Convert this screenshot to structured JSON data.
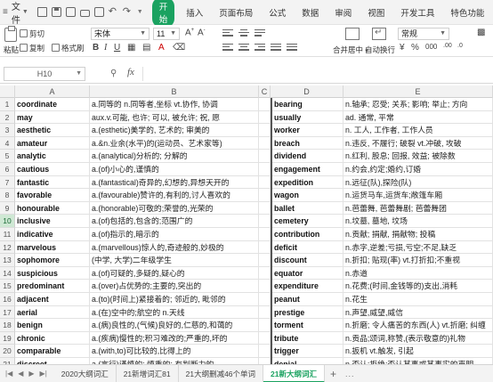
{
  "menu": {
    "file_label": "文件",
    "start_label": "开始",
    "tabs": [
      "插入",
      "页面布局",
      "公式",
      "数据",
      "审阅",
      "视图",
      "开发工具",
      "特色功能"
    ],
    "search_label": "查找"
  },
  "ribbon": {
    "cut_label": "剪切",
    "paste_label": "粘贴",
    "copy_label": "复制",
    "format_painter_label": "格式刷",
    "font_name": "宋体",
    "font_size": "11",
    "merge_label": "合并居中",
    "wrap_label": "自动换行",
    "number_format": "常规"
  },
  "formula_bar": {
    "name_box": "H10",
    "fx_label": "fx",
    "formula": ""
  },
  "columns": [
    "A",
    "B",
    "C",
    "D",
    "E"
  ],
  "rows": [
    {
      "n": "1",
      "a": "coordinate",
      "b": "a.同等的 n.同等者,坐标 vt.协作, 协调",
      "d": "bearing",
      "e": "n.轴承; 忍受; 关系; 影响; 举止; 方向"
    },
    {
      "n": "2",
      "a": "may",
      "b": "aux.v.可能, 也许; 可以, 被允许; 祝, 愿",
      "d": "usually",
      "e": "ad. 通常, 平常"
    },
    {
      "n": "3",
      "a": "aesthetic",
      "b": "a.(esthetic)美学的, 艺术的; 审美的",
      "d": "worker",
      "e": "n. 工人, 工作者, 工作人员"
    },
    {
      "n": "4",
      "a": "amateur",
      "b": "a.&n.业余(水平)的(运动员、艺术家等)",
      "d": "breach",
      "e": "n.违反, 不履行; 破裂 vt.冲破, 攻破"
    },
    {
      "n": "5",
      "a": "analytic",
      "b": "a.(analytical)分析的; 分解的",
      "d": "dividend",
      "e": "n.红利, 股息; 回报, 效益; 被除数"
    },
    {
      "n": "6",
      "a": "cautious",
      "b": "a.(of)小心的,谨慎的",
      "d": "engagement",
      "e": "n.约会,约定;婚约,订婚"
    },
    {
      "n": "7",
      "a": "fantastic",
      "b": "a.(fantastical)奇异的,幻想的,异想天开的",
      "d": "expedition",
      "e": "n.远征(队),探险(队)"
    },
    {
      "n": "8",
      "a": "favorable",
      "b": "a.(favourable)赞许的,有利的,讨人喜欢的",
      "d": "wagon",
      "e": "n.运货马车,运货车;敞篷车厢"
    },
    {
      "n": "9",
      "a": "honourable",
      "b": "a.(honorable)可敬的;荣誉的,光荣的",
      "d": "ballet",
      "e": "n.芭蕾舞, 芭蕾舞剧; 芭蕾舞团"
    },
    {
      "n": "10",
      "a": "inclusive",
      "b": "a.(of)包括的,包含的;范围广的",
      "d": "cemetery",
      "e": "n.坟墓, 墓地, 坟场"
    },
    {
      "n": "11",
      "a": "indicative",
      "b": "a.(of)指示的,暗示的",
      "d": "contribution",
      "e": "n.贡献; 捐献, 捐献物; 投稿"
    },
    {
      "n": "12",
      "a": "marvelous",
      "b": "a.(marvellous)惊人的,奇迹般的,妙极的",
      "d": "deficit",
      "e": "n.赤字,逆差;亏损,亏空;不足,缺乏"
    },
    {
      "n": "13",
      "a": "sophomore",
      "b": "(中学, 大学)二年级学生",
      "d": "discount",
      "e": "n.折扣; 贴现(率) vt.打折扣;不重视"
    },
    {
      "n": "14",
      "a": "suspicious",
      "b": "a.(of)可疑的,多疑的,疑心的",
      "d": "equator",
      "e": "n.赤道"
    },
    {
      "n": "15",
      "a": "predominant",
      "b": "a.(over)占优势的;主要的,突出的",
      "d": "expenditure",
      "e": "n.花费;(时间,金钱等的)支出,消耗"
    },
    {
      "n": "16",
      "a": "adjacent",
      "b": "a.(to)(时间上)紧接着的; 邻近的, 毗邻的",
      "d": "peanut",
      "e": "n.花生"
    },
    {
      "n": "17",
      "a": "aerial",
      "b": "a.(在)空中的;航空的 n.天线",
      "d": "prestige",
      "e": "n.声望,威望,威信"
    },
    {
      "n": "18",
      "a": "benign",
      "b": "a.(病)良性的,(气候)良好的,仁慈的,和蔼的",
      "d": "torment",
      "e": "n.折磨; 令人痛苦的东西(人) vt.折磨; 纠缠"
    },
    {
      "n": "19",
      "a": "chronic",
      "b": "a.(疾病)慢性的;积习难改的;严重的,坏的",
      "d": "tribute",
      "e": "n.贡品;颂词,称赞,(表示敬意的)礼物"
    },
    {
      "n": "20",
      "a": "comparable",
      "b": "a.(with,to)可比较的,比得上的",
      "d": "trigger",
      "e": "n.扳机 vt.触发, 引起"
    },
    {
      "n": "21",
      "a": "discreet",
      "b": "a.(言行)谨慎的; 慎重的; 有判断力的",
      "d": "denial",
      "e": "n.否认;拒绝;否认某事或某事实的声明"
    },
    {
      "n": "22",
      "a": "",
      "b": "",
      "d": "",
      "e": ""
    }
  ],
  "sheet_tabs": [
    "2020大纲词汇",
    "21新增词汇81",
    "21大纲删减46个单词",
    "21新大纲词汇"
  ],
  "active_sheet_index": 3,
  "sheet_more": "..."
}
